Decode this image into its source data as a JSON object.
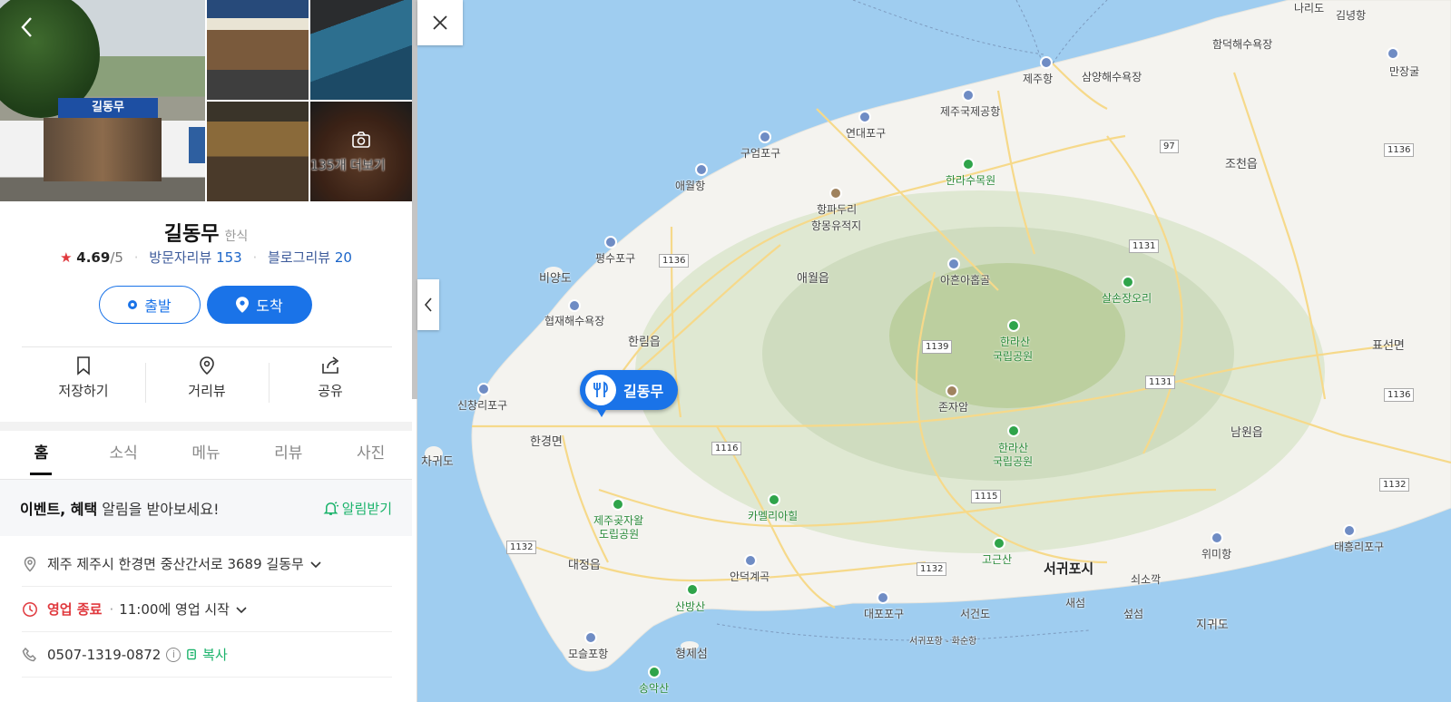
{
  "photos": {
    "more_label": "135개 더보기"
  },
  "place": {
    "name": "길동무",
    "category": "한식",
    "rating": "4.69",
    "rating_max": "/5",
    "visitor_review_label": "방문자리뷰",
    "visitor_review_count": "153",
    "blog_review_label": "블로그리뷰",
    "blog_review_count": "20"
  },
  "route": {
    "departure": "출발",
    "arrival": "도착"
  },
  "actions": {
    "save": "저장하기",
    "street_view": "거리뷰",
    "share": "공유"
  },
  "tabs": [
    "홈",
    "소식",
    "메뉴",
    "리뷰",
    "사진"
  ],
  "notice": {
    "strong": "이벤트, 혜택",
    "rest": "알림을 받아보세요!",
    "button": "알림받기"
  },
  "info": {
    "address": "제주 제주시 한경면 중산간서로 3689 길동무",
    "status": "영업 종료",
    "hours": "11:00에 영업 시작",
    "phone": "0507-1319-0872",
    "copy": "복사"
  },
  "map": {
    "pin_label": "길동무",
    "labels": {
      "jeju_port": "제주항",
      "samyang": "삼양해수욕장",
      "hamdeok": "함덕해수욕장",
      "gimnyeong": "김녕항",
      "manjang": "만장굴",
      "naryeo": "나리도",
      "airport": "제주국제공항",
      "yeondae": "연대포구",
      "gueom": "구엄포구",
      "aewol_port": "애월항",
      "halla_arboretum": "한라수목원",
      "hangpa1": "항파두리",
      "hangpa2": "항몽유적지",
      "jocheon": "조천읍",
      "gwidong": "평수포구",
      "biyang": "비양도",
      "aewol": "애월읍",
      "aheun": "아흔아홉골",
      "salson": "살손장오리",
      "hyeopjae": "협재해수욕장",
      "hallim": "한림읍",
      "hallasan1": "한라산",
      "hallasan1b": "국립공원",
      "pyoseon": "표선면",
      "sinchang": "신창리포구",
      "jonjaam": "존자암",
      "hallasan2": "한라산",
      "hallasan2b": "국립공원",
      "hangyeong": "한경면",
      "chagwido": "차귀도",
      "namwon": "남원읍",
      "arboretum_j1": "제주곶자왈",
      "arboretum_j2": "도립공원",
      "camellia": "카멜리아힐",
      "daejeong": "대정읍",
      "angdeok": "안덕계곡",
      "gogeunsan": "고근산",
      "seogwipo": "서귀포시",
      "taeheung": "태흥리포구",
      "wimi": "위미항",
      "soesokkak": "쇠소깍",
      "sanbangsan": "산방산",
      "daepo": "대포포구",
      "seogeondo": "서건도",
      "saeseom": "새섬",
      "seopseom": "섶섬",
      "jigwido": "지귀도",
      "moseulpo": "모슬포항",
      "hyeongje": "형제섬",
      "songaksan": "송악산",
      "ferry": "서귀포항 - 화순항"
    },
    "routes": [
      "1136",
      "1136",
      "97",
      "1136",
      "1131",
      "1131",
      "1139",
      "1116",
      "1115",
      "1132",
      "1132",
      "1136",
      "1132"
    ]
  }
}
